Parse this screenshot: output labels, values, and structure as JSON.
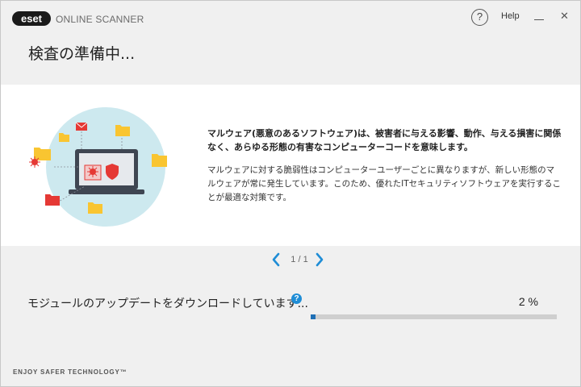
{
  "header": {
    "logo_text": "eset",
    "app_name": "ONLINE SCANNER",
    "help_label": "Help",
    "close_glyph": "✕"
  },
  "page": {
    "title": "検査の準備中..."
  },
  "info": {
    "bold_text": "マルウェア(悪意のあるソフトウェア)は、被害者に与える影響、動作、与える損害に関係なく、あらゆる形態の有害なコンピューターコードを意味します。",
    "body_text": "マルウェアに対する脆弱性はコンピューターユーザーごとに異なりますが、新しい形態のマルウェアが常に発生しています。このため、優れたITセキュリティソフトウェアを実行することが最適な対策です。"
  },
  "pager": {
    "count": "1 / 1"
  },
  "progress": {
    "status": "モジュールのアップデートをダウンロードしています...",
    "percent_text": "2 %",
    "value": 0.02
  },
  "footer": {
    "tagline": "ENJOY SAFER TECHNOLOGY™"
  },
  "colors": {
    "accent": "#1f8dd6",
    "progress_fill": "#1f6fb5",
    "folder": "#f9c531",
    "threat": "#e53935"
  },
  "icons": [
    "help-icon",
    "minimize-icon",
    "close-icon",
    "chevron-left-icon",
    "chevron-right-icon",
    "info-icon"
  ]
}
